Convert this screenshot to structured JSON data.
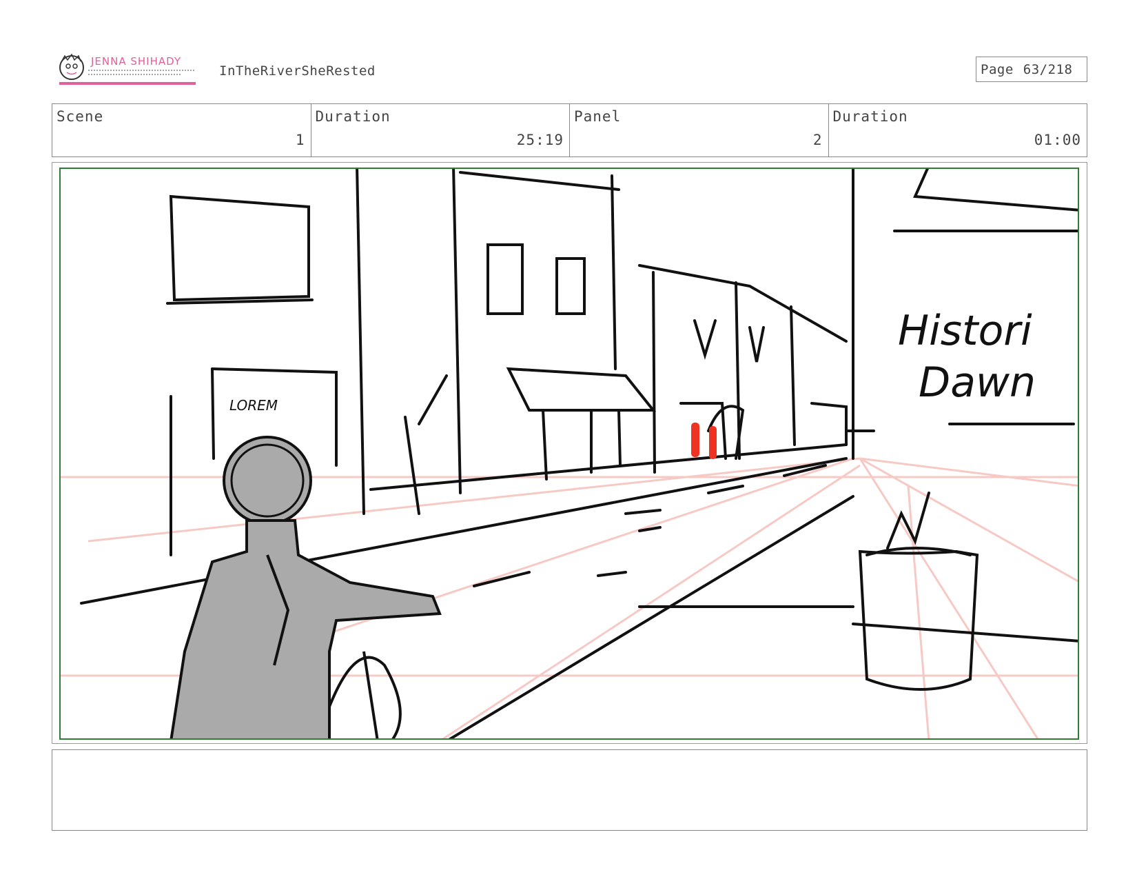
{
  "header": {
    "logo_text": "JENNA SHIHADY",
    "project_title": "InTheRiverSheRested",
    "page_label": "Page",
    "page_number": "63/218"
  },
  "info": {
    "scene_label": "Scene",
    "scene_value": "1",
    "scene_duration_label": "Duration",
    "scene_duration_value": "25:19",
    "panel_label": "Panel",
    "panel_value": "2",
    "panel_duration_label": "Duration",
    "panel_duration_value": "01:00"
  },
  "panel": {
    "sign_text_line1": "Histori",
    "sign_text_line2": "Dawn",
    "small_sign_text": "LOREM"
  },
  "notes": {
    "text": ""
  },
  "colors": {
    "safe_frame": "#2e7d32",
    "logo_pink": "#e0609a",
    "perspective_lines": "#f7c9c4",
    "figure_red": "#ee3322",
    "rider_gray": "#aaaaaa"
  }
}
